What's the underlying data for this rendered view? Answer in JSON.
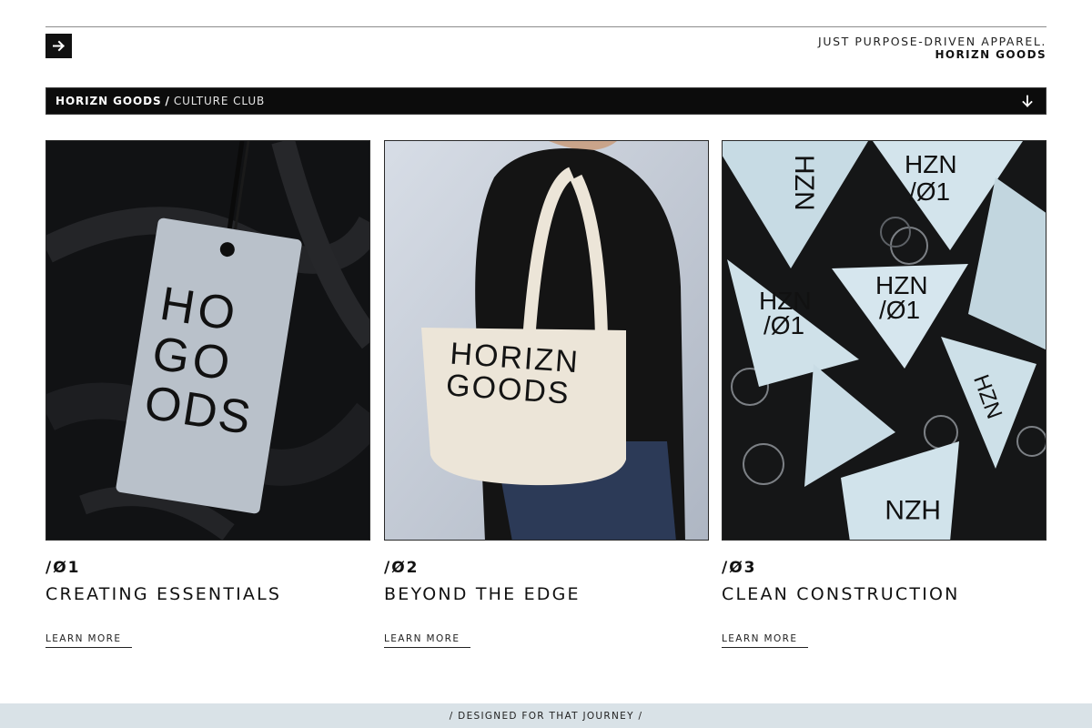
{
  "header": {
    "tagline": "JUST PURPOSE-DRIVEN APPAREL.",
    "brand": "HORIZN GOODS",
    "arrow_icon": "arrow-right-icon"
  },
  "breadcrumb": {
    "primary": "HORIZN GOODS",
    "separator": "/",
    "secondary": "CULTURE CLUB",
    "toggle_icon": "arrow-down-icon"
  },
  "cards": [
    {
      "number": "/Ø1",
      "title": "CREATING ESSENTIALS",
      "link": "LEARN MORE",
      "image_text": [
        "HO",
        "GO",
        "ODS"
      ]
    },
    {
      "number": "/Ø2",
      "title": "BEYOND THE EDGE",
      "link": "LEARN MORE",
      "image_text": [
        "HORIZN",
        "GOODS"
      ]
    },
    {
      "number": "/Ø3",
      "title": "CLEAN CONSTRUCTION",
      "link": "LEARN MORE",
      "image_text": [
        "HZN",
        "/Ø1"
      ]
    }
  ],
  "footer": {
    "text": "/ DESIGNED FOR THAT JOURNEY /"
  },
  "colors": {
    "ink": "#111111",
    "footer_bg": "#d9e2e7",
    "tag_blue": "#c7dbe4",
    "tote": "#ece5d8"
  }
}
